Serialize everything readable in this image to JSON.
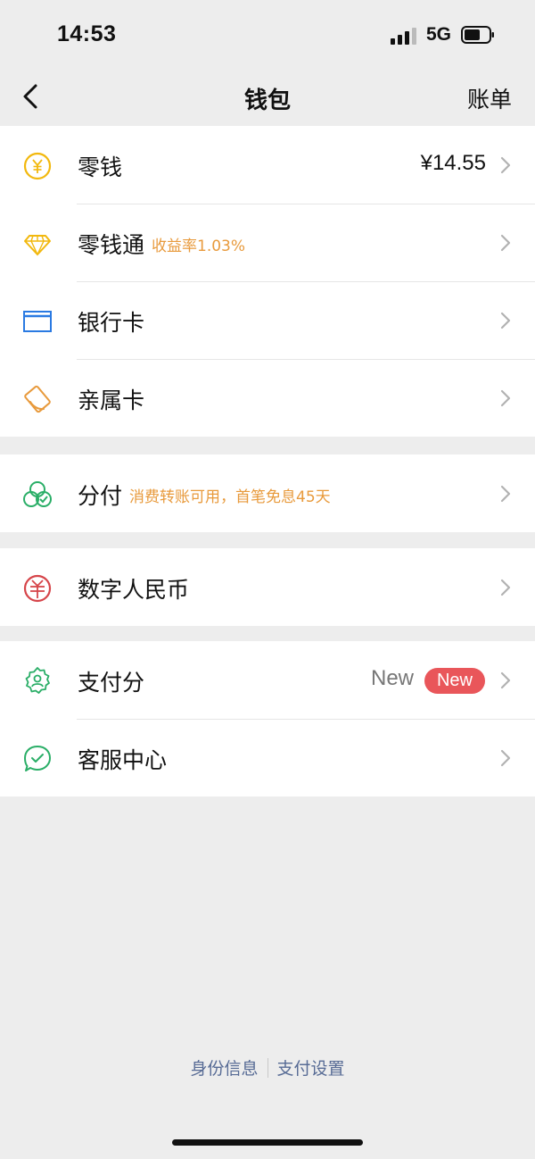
{
  "status_bar": {
    "time": "14:53",
    "network": "5G"
  },
  "nav": {
    "title": "钱包",
    "right_label": "账单"
  },
  "groups": [
    {
      "rows": [
        {
          "label": "零钱",
          "value": "¥14.55",
          "icon": "coin-yen-icon"
        },
        {
          "label": "零钱通",
          "sub": "收益率1.03%",
          "icon": "diamond-icon"
        },
        {
          "label": "银行卡",
          "icon": "bank-card-icon"
        },
        {
          "label": "亲属卡",
          "icon": "family-card-icon"
        }
      ]
    },
    {
      "rows": [
        {
          "label": "分付",
          "sub": "消费转账可用，首笔免息45天",
          "icon": "fenfu-icon"
        }
      ]
    },
    {
      "rows": [
        {
          "label": "数字人民币",
          "icon": "digital-rmb-icon"
        }
      ]
    },
    {
      "rows": [
        {
          "label": "支付分",
          "value": "New",
          "badge": "New",
          "icon": "pay-score-icon"
        },
        {
          "label": "客服中心",
          "icon": "customer-service-icon"
        }
      ]
    }
  ],
  "footer": {
    "left": "身份信息",
    "right": "支付设置"
  },
  "colors": {
    "gold": "#f2b80d",
    "blue": "#2a7ae2",
    "orange": "#e89a3c",
    "green": "#2aae67",
    "red": "#d6454a",
    "link": "#576b95",
    "badge": "#e9565a"
  }
}
